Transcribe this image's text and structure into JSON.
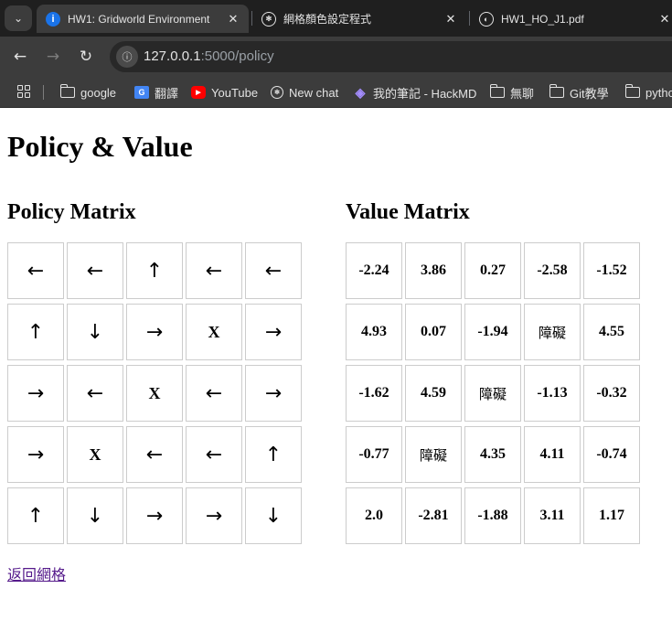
{
  "browser": {
    "tabs": [
      {
        "title": "HW1: Gridworld Environment",
        "favicon": "info-icon",
        "active": true
      },
      {
        "title": "網格顏色設定程式",
        "favicon": "openai-icon",
        "active": false
      },
      {
        "title": "HW1_HO_J1.pdf",
        "favicon": "globe-icon",
        "active": false
      }
    ],
    "close_glyph": "✕",
    "url_host": "127.0.0.1",
    "url_path": ":5000/policy",
    "bookmarks": [
      {
        "label": "google",
        "icon": "folder-icon"
      },
      {
        "label": "翻譯",
        "icon": "google-translate-icon"
      },
      {
        "label": "YouTube",
        "icon": "youtube-icon"
      },
      {
        "label": "New chat",
        "icon": "chatgpt-icon"
      },
      {
        "label": "我的筆記 - HackMD",
        "icon": "hackmd-icon"
      },
      {
        "label": "無聊",
        "icon": "folder-icon"
      },
      {
        "label": "Git教學",
        "icon": "folder-icon"
      },
      {
        "label": "pytho",
        "icon": "folder-icon"
      }
    ]
  },
  "page": {
    "title": "Policy & Value",
    "policy_heading": "Policy Matrix",
    "value_heading": "Value Matrix",
    "obstacle_policy": "X",
    "obstacle_value": "障礙",
    "policy": [
      [
        "←",
        "←",
        "↑",
        "←",
        "←"
      ],
      [
        "↑",
        "↓",
        "→",
        "X",
        "→"
      ],
      [
        "→",
        "←",
        "X",
        "←",
        "→"
      ],
      [
        "→",
        "X",
        "←",
        "←",
        "↑"
      ],
      [
        "↑",
        "↓",
        "→",
        "→",
        "↓"
      ]
    ],
    "values": [
      [
        "-2.24",
        "3.86",
        "0.27",
        "-2.58",
        "-1.52"
      ],
      [
        "4.93",
        "0.07",
        "-1.94",
        "障礙",
        "4.55"
      ],
      [
        "-1.62",
        "4.59",
        "障礙",
        "-1.13",
        "-0.32"
      ],
      [
        "-0.77",
        "障礙",
        "4.35",
        "4.11",
        "-0.74"
      ],
      [
        "2.0",
        "-2.81",
        "-1.88",
        "3.11",
        "1.17"
      ]
    ],
    "back_link": "返回網格"
  },
  "colors": {
    "link_visited": "#551a8b",
    "cell_border": "#cccccc",
    "tabbar_bg": "#1f1f1f",
    "toolbar_bg": "#3c3c3c"
  }
}
